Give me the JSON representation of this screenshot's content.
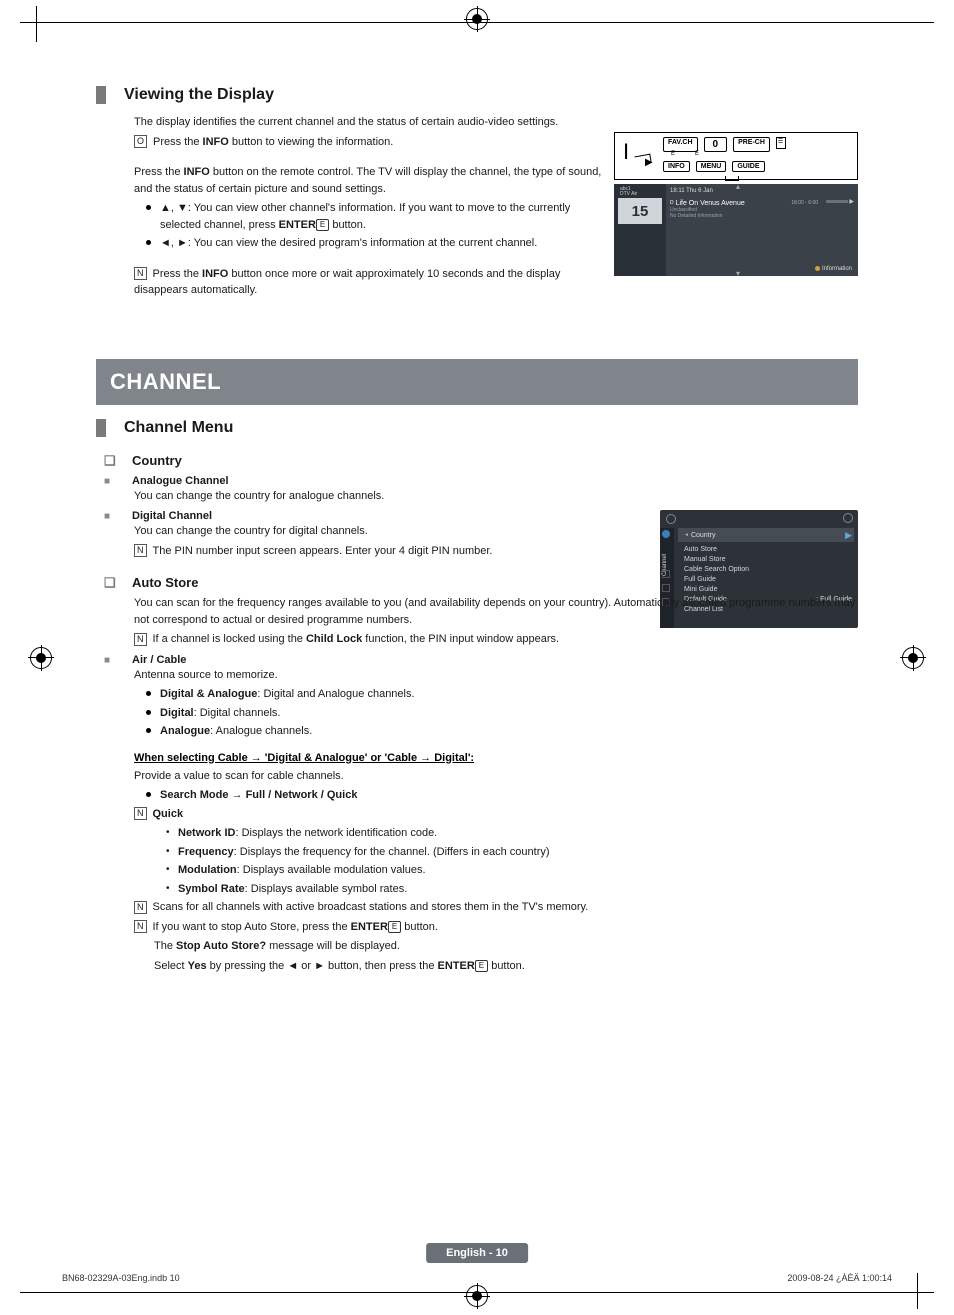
{
  "section1": {
    "title": "Viewing the Display",
    "p1": "The display identifies the current channel and the status of certain audio-video settings.",
    "note_icon": "O",
    "p1_note": "Press the INFO button to viewing the information.",
    "p2_a": "Press the ",
    "p2_b": "INFO",
    "p2_c": " button on the remote control. The TV will display the channel, the type of sound, and the status of certain picture and sound settings.",
    "b1_a": "▲, ▼: You can view other channel's information. If you want to move to the currently selected channel, press ",
    "b1_b": "ENTER",
    "b1_c": " button.",
    "b2": "◄, ►: You can view the desired program's information at the current channel.",
    "note2_icon": "N",
    "note2_a": "Press the ",
    "note2_b": "INFO",
    "note2_c": " button once more or wait approximately 10 seconds and the display disappears automatically."
  },
  "remote": {
    "fav": "FAV.CH",
    "zero": "0",
    "pre": "PRE-CH",
    "info": "INFO",
    "menu": "MENU",
    "guide": "GUIDE",
    "ex1": "E",
    "ex2": "E"
  },
  "info_display": {
    "abc": "abc1",
    "dtv": "DTV Air",
    "ch": "15",
    "time": "18:11 Thu 6 Jan",
    "prog": "Life On Venus Avenue",
    "unclass": "Unclassified",
    "nodetail": "No Detailed Information",
    "range": "18:00 - 6:00",
    "info_btn": "Information",
    "d_mark": "D"
  },
  "channel_banner": "CHANNEL",
  "section2": {
    "title": "Channel Menu",
    "country": {
      "q_title": "Country",
      "analogue_t": "Analogue Channel",
      "analogue_d": "You can change the country for analogue channels.",
      "digital_t": "Digital Channel",
      "digital_d": "You can change the country for digital channels.",
      "note_icon": "N",
      "digital_note": "The PIN number input screen appears. Enter your 4 digit PIN number."
    },
    "auto_store": {
      "q_title": "Auto Store",
      "p1": "You can scan for the frequency ranges available to you (and availability depends on your country). Automatically allocated programme numbers may not correspond to actual or desired programme numbers.",
      "note_icon": "N",
      "note1_a": "If a channel is locked using the ",
      "note1_b": "Child Lock",
      "note1_c": " function, the PIN input window appears.",
      "air_t": "Air / Cable",
      "air_d": "Antenna source to memorize.",
      "da_b": "Digital & Analogue",
      "da_d": ": Digital and Analogue channels.",
      "d_b": "Digital",
      "d_d": ": Digital channels.",
      "a_b": "Analogue",
      "a_d": ": Analogue channels.",
      "cable_title": "When selecting Cable → 'Digital & Analogue' or 'Cable → Digital':",
      "cable_p": "Provide a value to scan for cable channels.",
      "search_mode": "Search Mode → Full / Network / Quick",
      "quick_t": "Quick",
      "netid_b": "Network ID",
      "netid_d": ": Displays the network identification code.",
      "freq_b": "Frequency",
      "freq_d": ": Displays the frequency for the channel. (Differs in each country)",
      "mod_b": "Modulation",
      "mod_d": ": Displays available modulation values.",
      "sym_b": "Symbol Rate",
      "sym_d": ": Displays available symbol rates.",
      "note2": "Scans for all channels with active broadcast stations and stores them in the TV's memory.",
      "note3_a": "If you want to stop Auto Store, press the ",
      "note3_b": "ENTER",
      "note3_c": " button.",
      "note3_d_a": "The ",
      "note3_d_b": "Stop Auto Store?",
      "note3_d_c": " message will be displayed.",
      "note3_e_a": "Select ",
      "note3_e_b": "Yes",
      "note3_e_c": " by pressing the ◄ or ► button, then press the ",
      "note3_e_d": "ENTER",
      "note3_e_e": " button."
    }
  },
  "osd": {
    "tab": "Channel",
    "country": "Country",
    "items": [
      "Auto Store",
      "Manual Store",
      "Cable Search Option",
      "Full Guide",
      "Mini Guide",
      "Default Guide",
      "Channel List"
    ],
    "default_val": ": Full Guide",
    "arrow": "▶"
  },
  "enter_icon": "E",
  "footer": {
    "page": "English - 10",
    "left": "BN68-02329A-03Eng.indb   10",
    "right": "2009-08-24   ¿ÀÈÄ 1:00:14"
  }
}
